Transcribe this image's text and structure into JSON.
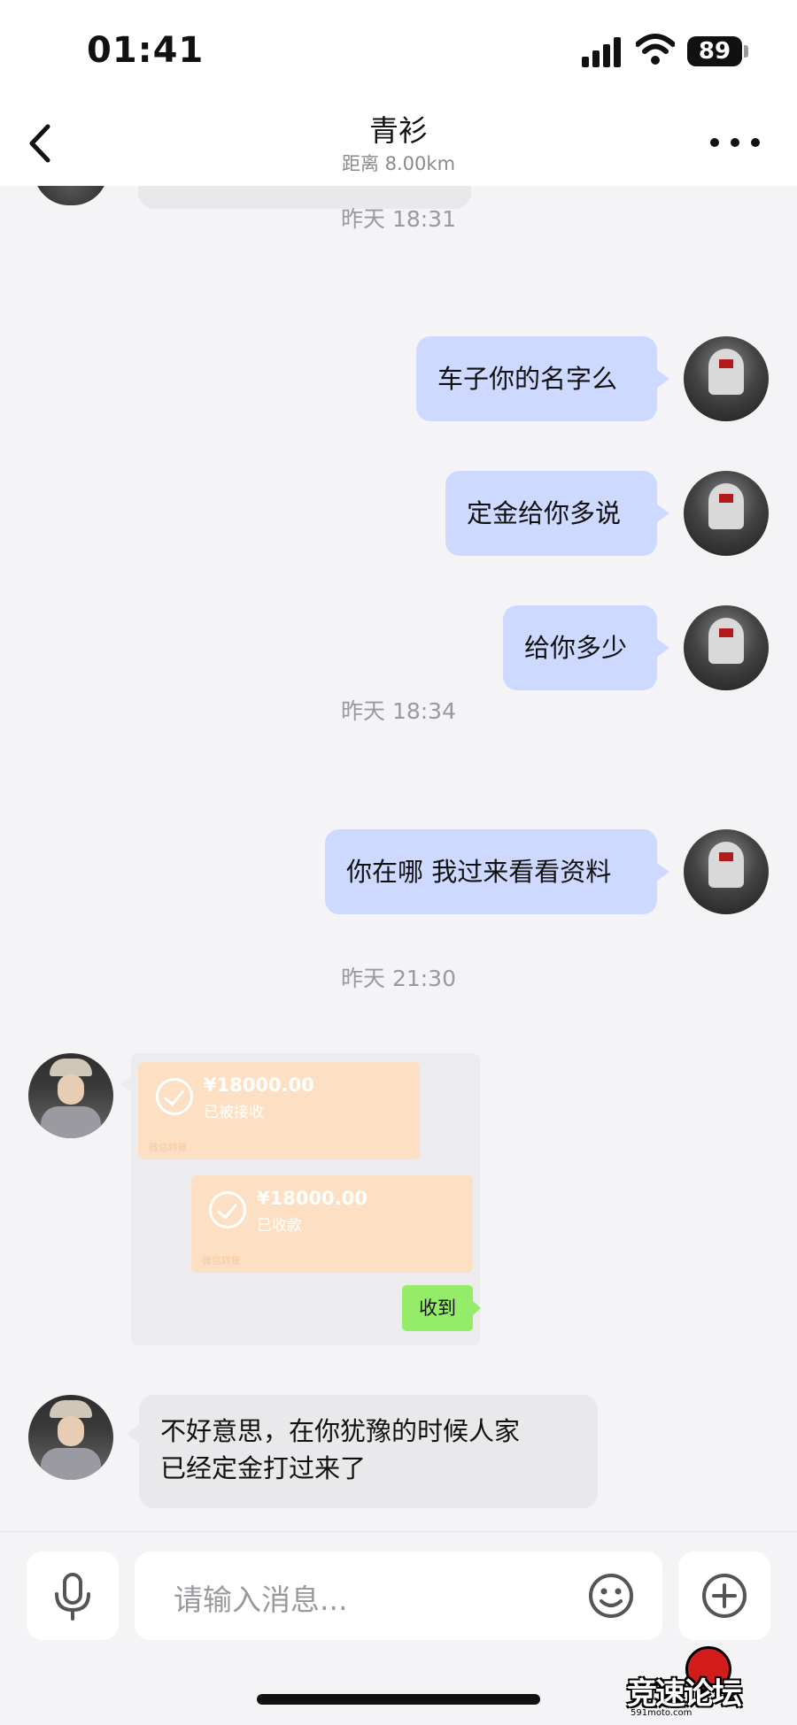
{
  "status_bar": {
    "time": "01:41",
    "battery": "89"
  },
  "nav": {
    "title": "青衫",
    "subtitle": "距离 8.00km"
  },
  "messages": {
    "ts1": "昨天 18:31",
    "m1": "车子你的名字么",
    "m2": "定金给你多说",
    "m3": "给你多少",
    "ts2": "昨天 18:34",
    "m4": "你在哪 我过来看看资料",
    "ts3": "昨天 21:30",
    "transfer1": {
      "amount": "¥18000.00",
      "status": "已被接收",
      "source": "微信转账"
    },
    "transfer2": {
      "amount": "¥18000.00",
      "status": "已收款",
      "source": "微信转账"
    },
    "received": "收到",
    "m5_line1": "不好意思，在你犹豫的时候人家",
    "m5_line2": "已经定金打过来了"
  },
  "input": {
    "placeholder": "请输入消息..."
  },
  "watermark": {
    "text": "竞速论坛",
    "url": "591moto.com"
  },
  "colors": {
    "outgoing_bubble": "#cdd9ff",
    "incoming_bubble": "#e9e9eb",
    "transfer_card": "#fde0c3",
    "received_button": "#95ec69"
  },
  "icons": [
    "back-icon",
    "more-icon",
    "microphone-icon",
    "emoji-icon",
    "plus-icon",
    "signal-icon",
    "wifi-icon",
    "battery-icon"
  ]
}
